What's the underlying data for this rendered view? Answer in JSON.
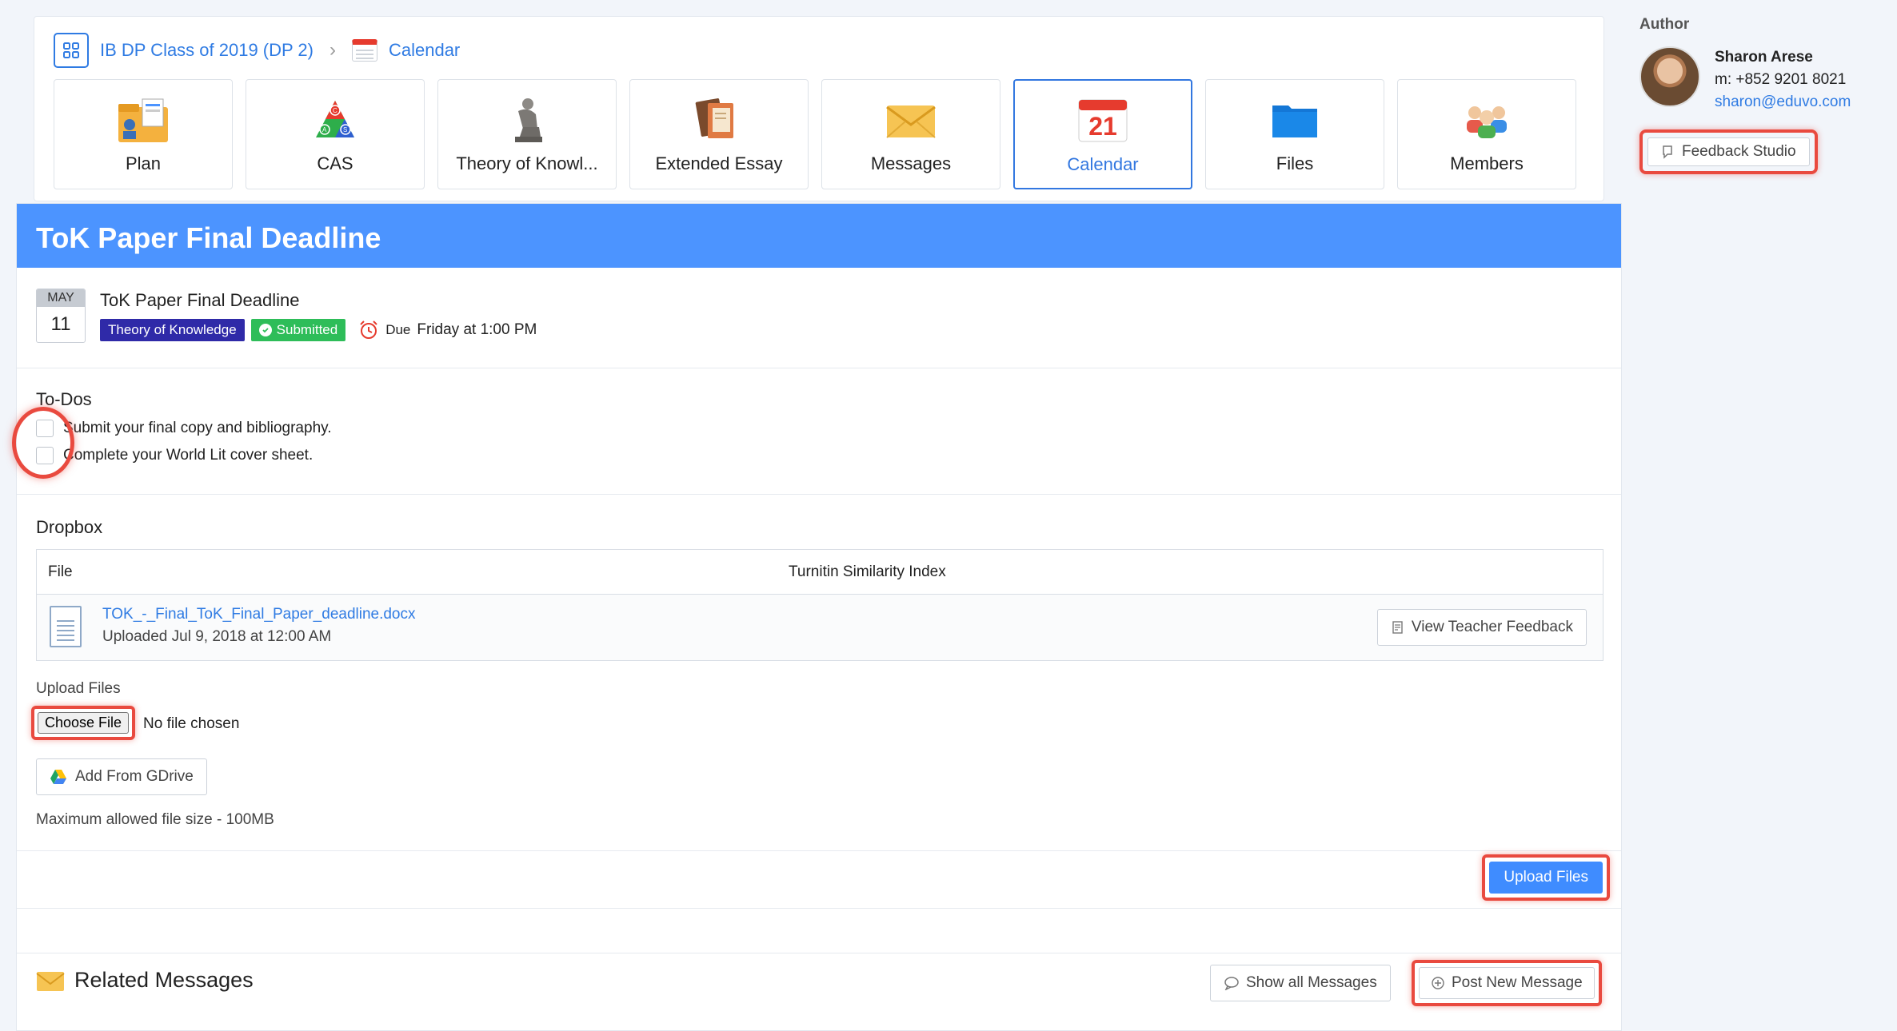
{
  "breadcrumb": {
    "class_name": "IB DP Class of 2019 (DP 2)",
    "separator": "›",
    "current": "Calendar"
  },
  "tiles": [
    {
      "label": "Plan",
      "icon": "plan-icon"
    },
    {
      "label": "CAS",
      "icon": "cas-icon"
    },
    {
      "label": "Theory of Knowl...",
      "icon": "thinker-statue-icon"
    },
    {
      "label": "Extended Essay",
      "icon": "books-icon"
    },
    {
      "label": "Messages",
      "icon": "envelope-icon"
    },
    {
      "label": "Calendar",
      "icon": "calendar-icon",
      "active": true,
      "day": "21"
    },
    {
      "label": "Files",
      "icon": "folder-icon"
    },
    {
      "label": "Members",
      "icon": "members-icon"
    }
  ],
  "author": {
    "heading": "Author",
    "name": "Sharon Arese",
    "phone": "m: +852 9201 8021",
    "email": "sharon@eduvo.com",
    "feedback_button": "Feedback Studio"
  },
  "event": {
    "header": "ToK Paper Final Deadline",
    "date_month": "MAY",
    "date_day": "11",
    "title": "ToK Paper Final Deadline",
    "subject_tag": "Theory of Knowledge",
    "status_tag": "Submitted",
    "due_label": "Due",
    "due_time": "Friday at 1:00 PM"
  },
  "todos": {
    "title": "To-Dos",
    "items": [
      {
        "label": "Submit your final copy and bibliography.",
        "checked": false
      },
      {
        "label": "Complete your World Lit cover sheet.",
        "checked": false
      }
    ]
  },
  "dropbox": {
    "title": "Dropbox",
    "columns": [
      "File",
      "Turnitin Similarity Index"
    ],
    "files": [
      {
        "name": "TOK_-_Final_ToK_Final_Paper_deadline.docx",
        "uploaded": "Uploaded Jul 9, 2018 at 12:00 AM",
        "action": "View Teacher Feedback"
      }
    ],
    "upload_label": "Upload Files",
    "choose_file": "Choose File",
    "no_file": "No file chosen",
    "gdrive_button": "Add From GDrive",
    "max_size": "Maximum allowed file size - 100MB",
    "upload_button": "Upload Files"
  },
  "related": {
    "title": "Related Messages",
    "show_all": "Show all Messages",
    "post_new": "Post New Message"
  },
  "colors": {
    "accent": "#4c94ff",
    "link": "#2f7be3",
    "tok_tag": "#2f2aa8",
    "submitted_tag": "#2ebd59",
    "highlight": "#e94a3f"
  }
}
